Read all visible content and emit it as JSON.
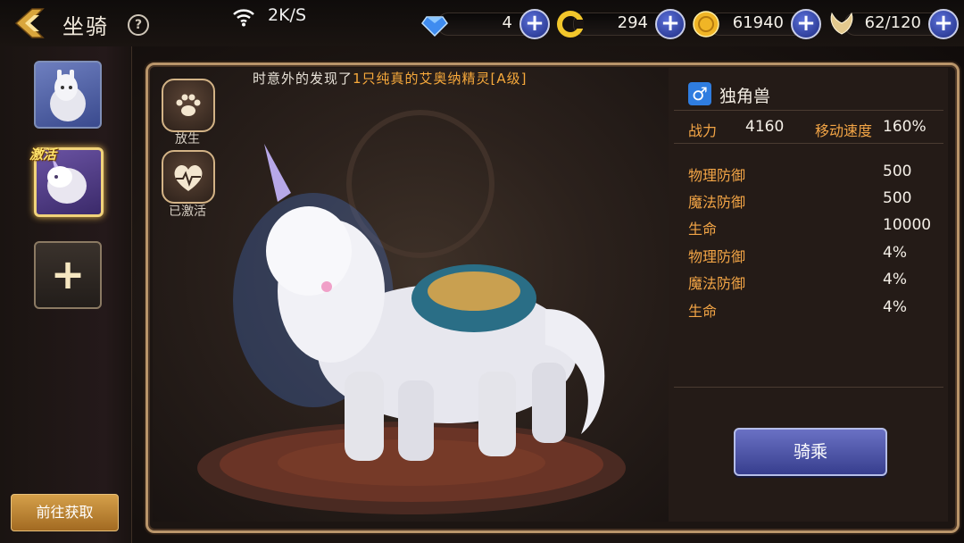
{
  "header": {
    "title": "坐骑",
    "help_label": "?",
    "network_speed": "2K/S"
  },
  "resources": [
    {
      "name": "diamond",
      "value": "4",
      "color": "#3f8cf0"
    },
    {
      "name": "gold-ticket",
      "value": "294",
      "color": "#f2c62b"
    },
    {
      "name": "gold-coin",
      "value": "61940",
      "color": "#f0b526"
    },
    {
      "name": "stamina-wing",
      "value": "62/120",
      "color": "#e3c98e"
    }
  ],
  "sidebar": {
    "active_tag": "激活",
    "add_label": "+",
    "goto_label": "前往获取"
  },
  "stage": {
    "notice_prefix": "时意外的发现了",
    "notice_highlight": "1只纯真的艾奥纳精灵[A级]",
    "release_label": "放生",
    "activated_label": "已激活"
  },
  "mount": {
    "gender_symbol": "♂",
    "name": "独角兽",
    "power_label": "战力",
    "power_value": "4160",
    "speed_label": "移动速度",
    "speed_value": "160%",
    "stats": [
      {
        "label": "物理防御",
        "value": "500"
      },
      {
        "label": "魔法防御",
        "value": "500"
      },
      {
        "label": "生命",
        "value": "10000"
      },
      {
        "label": "物理防御",
        "value": "4%"
      },
      {
        "label": "魔法防御",
        "value": "4%"
      },
      {
        "label": "生命",
        "value": "4%"
      }
    ],
    "ride_label": "骑乘"
  }
}
